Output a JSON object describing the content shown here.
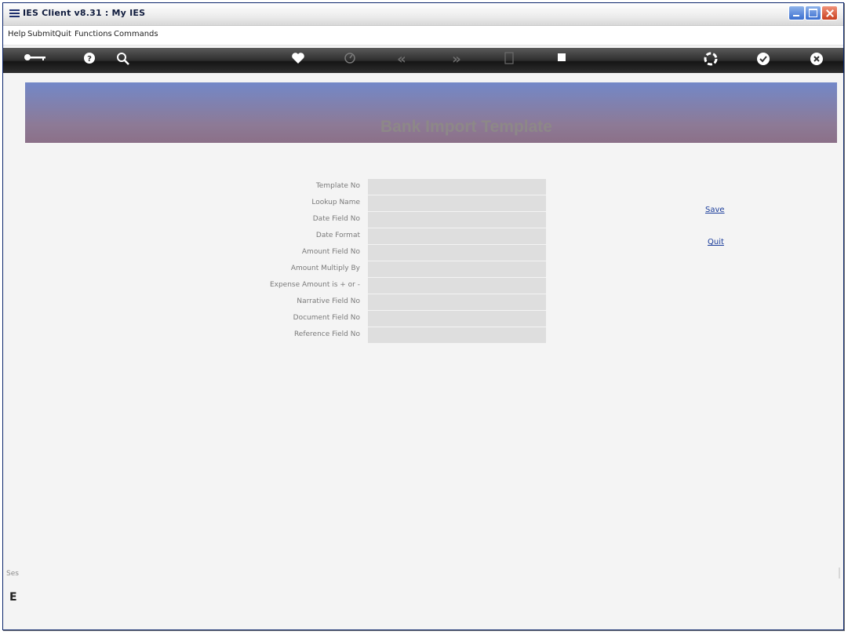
{
  "window": {
    "title": "IES Client v8.31 : My IES"
  },
  "menubar": {
    "items": [
      "Help",
      "Submit",
      "Quit",
      "Functions",
      "Commands"
    ]
  },
  "toolbar": {
    "icons": [
      {
        "name": "key-icon",
        "glyph": "⊶",
        "enabled": true
      },
      {
        "name": "help-icon",
        "glyph": "?",
        "enabled": true
      },
      {
        "name": "search-icon",
        "glyph": "🔍",
        "enabled": true
      },
      {
        "name": "heart-icon",
        "glyph": "♥",
        "enabled": true
      },
      {
        "name": "clock-icon",
        "glyph": "◷",
        "enabled": false
      },
      {
        "name": "rewind-icon",
        "glyph": "«",
        "enabled": false
      },
      {
        "name": "fast-forward-icon",
        "glyph": "»",
        "enabled": false
      },
      {
        "name": "document-icon",
        "glyph": "▯",
        "enabled": false
      },
      {
        "name": "stop-icon",
        "glyph": "■",
        "enabled": true
      },
      {
        "name": "refresh-icon",
        "glyph": "✿",
        "enabled": true
      },
      {
        "name": "check-icon",
        "glyph": "✔",
        "enabled": true
      },
      {
        "name": "cancel-icon",
        "glyph": "✕",
        "enabled": true
      }
    ]
  },
  "page": {
    "title": "Bank Import Template"
  },
  "form": {
    "fields": [
      {
        "label": "Template No",
        "value": ""
      },
      {
        "label": "Lookup Name",
        "value": ""
      },
      {
        "label": "Date Field No",
        "value": ""
      },
      {
        "label": "Date Format",
        "value": ""
      },
      {
        "label": "Amount Field No",
        "value": ""
      },
      {
        "label": "Amount Multiply By",
        "value": ""
      },
      {
        "label": "Expense Amount is + or -",
        "value": ""
      },
      {
        "label": "Narrative Field No",
        "value": ""
      },
      {
        "label": "Document Field No",
        "value": ""
      },
      {
        "label": "Reference Field No",
        "value": ""
      }
    ]
  },
  "actions": {
    "save_label": "Save",
    "quit_label": "Quit"
  },
  "status": {
    "label": "Ses",
    "glyph": "E"
  },
  "colors": {
    "banner_top": "#7388c8",
    "banner_bottom": "#8b7088",
    "field_bg": "#dedede",
    "link": "#1a3c9a"
  }
}
